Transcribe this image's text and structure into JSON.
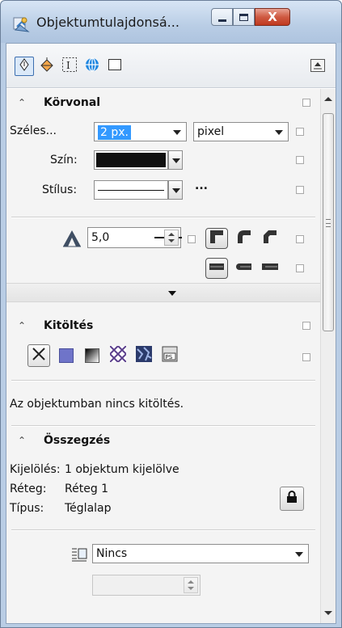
{
  "window": {
    "title": "Objektumtulajdonsá...",
    "min_icon": "minimize-icon",
    "max_icon": "maximize-icon",
    "close_label": "X"
  },
  "toolbar": {
    "tabs": [
      {
        "name": "outline-pen-icon",
        "active": true
      },
      {
        "name": "fill-bucket-icon",
        "active": false
      },
      {
        "name": "text-frame-icon",
        "active": false
      },
      {
        "name": "internet-globe-icon",
        "active": false
      },
      {
        "name": "rectangle-icon",
        "active": false
      }
    ],
    "right_icon": "popout-icon"
  },
  "outline": {
    "title": "Körvonal",
    "width_label": "Széles...",
    "width_value": "2 px.",
    "unit_value": "pixel",
    "color_label": "Szín:",
    "color_value": "#111111",
    "style_label": "Stílus:",
    "more_label": "...",
    "miter_value": "5,0"
  },
  "fill": {
    "title": "Kitöltés",
    "message": "Az objektumban nincs kitöltés."
  },
  "summary": {
    "title": "Összegzés",
    "selection_label": "Kijelölés:",
    "selection_value": "1 objektum kijelölve",
    "layer_label": "Réteg:",
    "layer_value": "Réteg 1",
    "type_label": "Típus:",
    "type_value": "Téglalap",
    "wrap_value": "Nincs"
  },
  "colors": {
    "accent": "#3399ff",
    "fill_blue": "#6f74c9"
  }
}
